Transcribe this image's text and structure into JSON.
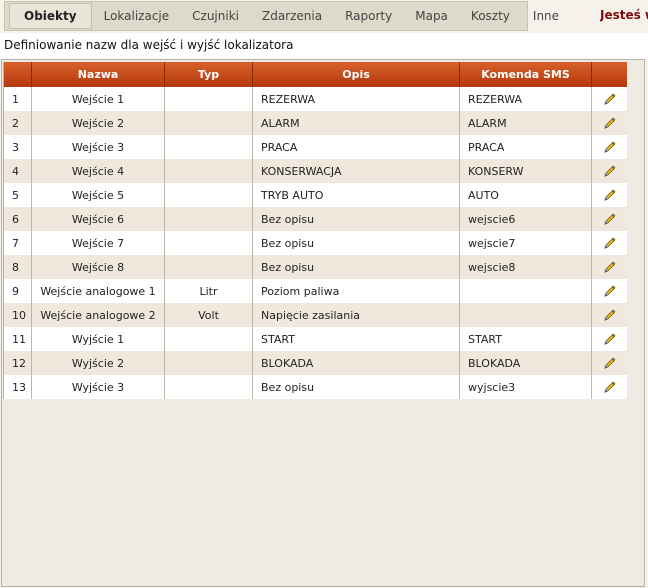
{
  "nav": {
    "items": [
      {
        "label": "Obiekty",
        "active": true
      },
      {
        "label": "Lokalizacje"
      },
      {
        "label": "Czujniki"
      },
      {
        "label": "Zdarzenia"
      },
      {
        "label": "Raporty"
      },
      {
        "label": "Mapa"
      },
      {
        "label": "Koszty"
      },
      {
        "label": "Inne"
      }
    ],
    "user_text": "Jesteś w"
  },
  "page": {
    "title": "Definiowanie nazw dla wejść i wyjść lokalizatora"
  },
  "table": {
    "headers": {
      "nr": "",
      "name": "Nazwa",
      "type": "Typ",
      "description": "Opis",
      "sms_command": "Komenda SMS",
      "edit": ""
    },
    "rows": [
      {
        "nr": "1",
        "name": "Wejście 1",
        "type": "",
        "description": "REZERWA",
        "sms": "REZERWA"
      },
      {
        "nr": "2",
        "name": "Wejście 2",
        "type": "",
        "description": "ALARM",
        "sms": "ALARM"
      },
      {
        "nr": "3",
        "name": "Wejście 3",
        "type": "",
        "description": "PRACA",
        "sms": "PRACA"
      },
      {
        "nr": "4",
        "name": "Wejście 4",
        "type": "",
        "description": "KONSERWACJA",
        "sms": "KONSERW"
      },
      {
        "nr": "5",
        "name": "Wejście 5",
        "type": "",
        "description": "TRYB AUTO",
        "sms": "AUTO"
      },
      {
        "nr": "6",
        "name": "Wejście 6",
        "type": "",
        "description": "Bez opisu",
        "sms": "wejscie6"
      },
      {
        "nr": "7",
        "name": "Wejście 7",
        "type": "",
        "description": "Bez opisu",
        "sms": "wejscie7"
      },
      {
        "nr": "8",
        "name": "Wejście 8",
        "type": "",
        "description": "Bez opisu",
        "sms": "wejscie8"
      },
      {
        "nr": "9",
        "name": "Wejście analogowe 1",
        "type": "Litr",
        "description": "Poziom paliwa",
        "sms": ""
      },
      {
        "nr": "10",
        "name": "Wejście analogowe 2",
        "type": "Volt",
        "description": "Napięcie zasilania",
        "sms": ""
      },
      {
        "nr": "11",
        "name": "Wyjście 1",
        "type": "",
        "description": "START",
        "sms": "START"
      },
      {
        "nr": "12",
        "name": "Wyjście 2",
        "type": "",
        "description": "BLOKADA",
        "sms": "BLOKADA"
      },
      {
        "nr": "13",
        "name": "Wyjście 3",
        "type": "",
        "description": "Bez opisu",
        "sms": "wyjscie3"
      }
    ],
    "edit_icon": "pencil-icon"
  },
  "colors": {
    "header_top": "#d7612b",
    "header_bottom": "#b4370c",
    "row_alt": "#f1e8dd",
    "user_text": "#7a0b0b"
  }
}
